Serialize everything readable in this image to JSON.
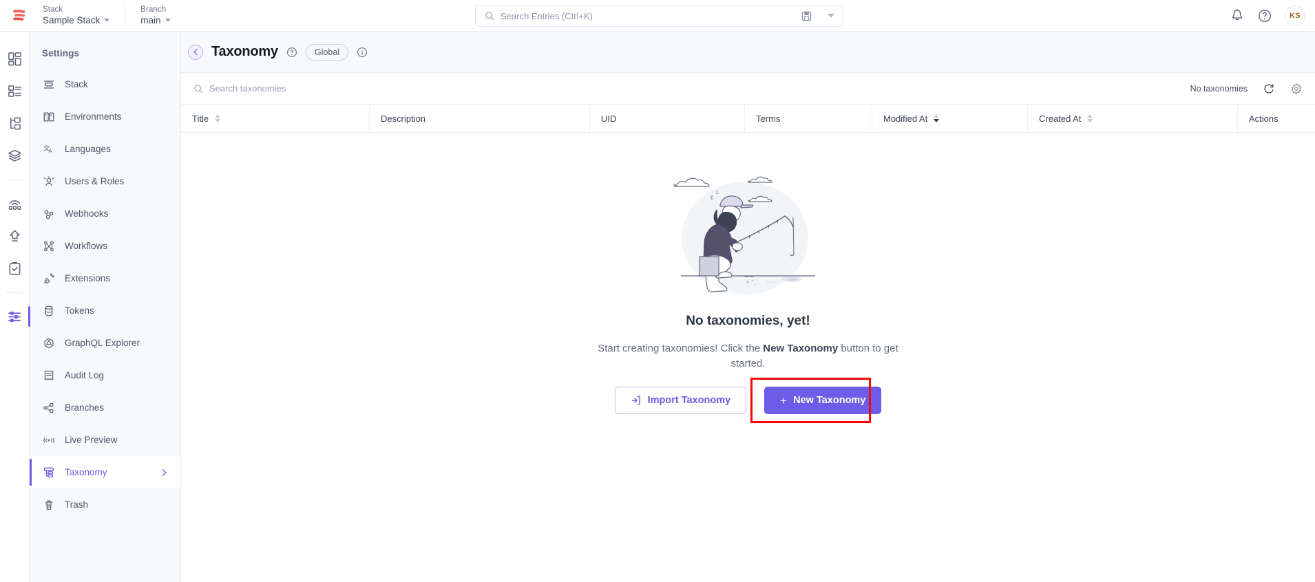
{
  "topbar": {
    "logo_icon": "contentstack-logo-icon",
    "stack": {
      "label": "Stack",
      "value": "Sample Stack"
    },
    "branch": {
      "label": "Branch",
      "value": "main"
    },
    "search": {
      "placeholder": "Search Entries (Ctrl+K)",
      "icon": "search-icon",
      "save_icon": "save-disk-icon",
      "dropdown_icon": "chevron-down-icon"
    },
    "notifications_icon": "bell-icon",
    "help_icon": "question-circle-icon",
    "avatar_initials": "KS"
  },
  "rail": {
    "items": [
      {
        "name": "dashboard",
        "icon": "dashboard-grid-icon"
      },
      {
        "name": "content-types",
        "icon": "content-type-list-icon"
      },
      {
        "name": "modular-blocks",
        "icon": "modular-blocks-icon"
      },
      {
        "name": "assets",
        "icon": "layers-stack-icon"
      },
      {
        "name": "live-preview",
        "icon": "broadcast-icon"
      },
      {
        "name": "releases",
        "icon": "publish-upload-icon"
      },
      {
        "name": "tasks",
        "icon": "clipboard-check-icon"
      },
      {
        "name": "settings",
        "icon": "sliders-settings-icon"
      }
    ]
  },
  "sidebar": {
    "title": "Settings",
    "items": [
      {
        "label": "Stack",
        "icon": "stack-icon"
      },
      {
        "label": "Environments",
        "icon": "environments-icon"
      },
      {
        "label": "Languages",
        "icon": "languages-icon"
      },
      {
        "label": "Users & Roles",
        "icon": "users-roles-icon"
      },
      {
        "label": "Webhooks",
        "icon": "webhooks-icon"
      },
      {
        "label": "Workflows",
        "icon": "workflows-icon"
      },
      {
        "label": "Extensions",
        "icon": "extensions-plug-icon"
      },
      {
        "label": "Tokens",
        "icon": "tokens-database-icon"
      },
      {
        "label": "GraphQL Explorer",
        "icon": "graphql-icon"
      },
      {
        "label": "Audit Log",
        "icon": "audit-log-icon"
      },
      {
        "label": "Branches",
        "icon": "branches-icon"
      },
      {
        "label": "Live Preview",
        "icon": "live-preview-icon"
      },
      {
        "label": "Taxonomy",
        "icon": "taxonomy-icon",
        "active": true,
        "chevron": "chevron-right-icon"
      },
      {
        "label": "Trash",
        "icon": "trash-icon"
      }
    ]
  },
  "page": {
    "back_icon": "chevron-left-circle-icon",
    "title": "Taxonomy",
    "help_icon": "question-circle-icon",
    "scope_badge": "Global",
    "info_icon": "info-circle-icon"
  },
  "toolbar": {
    "search_placeholder": "Search taxonomies",
    "search_icon": "search-icon",
    "count_text": "No taxonomies",
    "refresh_icon": "refresh-icon",
    "settings_icon": "gear-icon"
  },
  "table": {
    "columns": [
      {
        "label": "Title",
        "sortable": true,
        "sort": "none"
      },
      {
        "label": "Description",
        "sortable": false
      },
      {
        "label": "UID",
        "sortable": false
      },
      {
        "label": "Terms",
        "sortable": false
      },
      {
        "label": "Modified At",
        "sortable": true,
        "sort": "desc"
      },
      {
        "label": "Created At",
        "sortable": true,
        "sort": "none"
      },
      {
        "label": "Actions",
        "sortable": false
      }
    ],
    "rows": []
  },
  "empty_state": {
    "illustration": "fisherman-empty-illustration",
    "heading": "No taxonomies, yet!",
    "body_prefix": "Start creating taxonomies! Click the ",
    "body_strong": "New Taxonomy",
    "body_suffix": " button to get started.",
    "import_button": "Import Taxonomy",
    "import_icon": "import-arrow-icon",
    "new_button": "New Taxonomy",
    "new_icon": "plus-icon"
  },
  "colors": {
    "accent_purple": "#6c5ce7",
    "annotation_red": "#ff0000",
    "sidebar_bg": "#f8f9fc",
    "text_dark": "#2d3545"
  }
}
